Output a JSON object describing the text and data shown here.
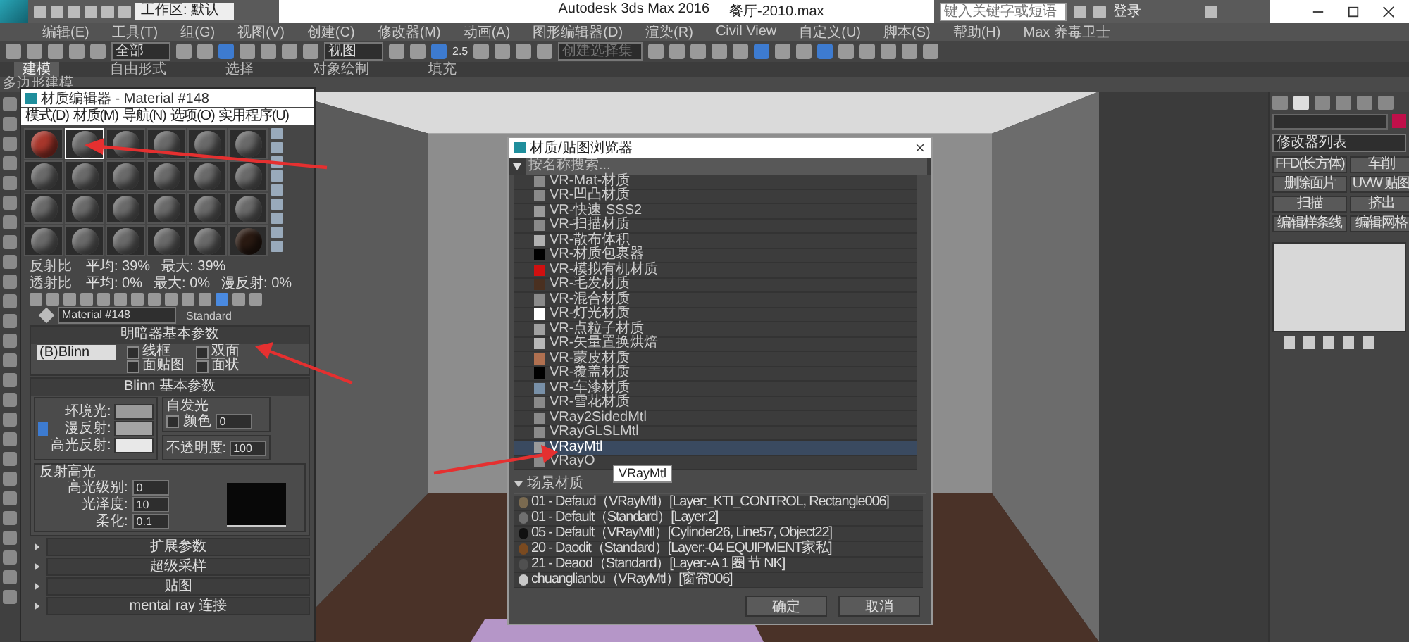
{
  "title_bar": {
    "workspace": "工作区: 默认",
    "app_title": "Autodesk 3ds Max 2016",
    "file_name": "餐厅-2010.max",
    "search": {
      "placeholder": "键入关键字或短语"
    },
    "user": "登录"
  },
  "menu_bar": [
    "编辑(E)",
    "工具(T)",
    "组(G)",
    "视图(V)",
    "创建(C)",
    "修改器(M)",
    "动画(A)",
    "图形编辑器(D)",
    "渲染(R)",
    "Civil View",
    "自定义(U)",
    "脚本(S)",
    "帮助(H)",
    "Max 养毒卫士"
  ],
  "toolbar": {
    "selection_filter": "全部",
    "coordinate_system": "视图",
    "snap_label": "2.5",
    "named_selection": {
      "placeholder": "创建选择集"
    }
  },
  "ribbon": {
    "tabs": [
      {
        "label": "建模",
        "selected": true
      },
      {
        "label": "自由形式",
        "selected": false
      },
      {
        "label": "选择",
        "selected": false
      },
      {
        "label": "对象绘制",
        "selected": false
      },
      {
        "label": "填充",
        "selected": false
      }
    ],
    "panel_label": "多边形建模"
  },
  "material_editor": {
    "title": "材质编辑器 - Material #148",
    "menu": [
      "模式(D)",
      "材质(M)",
      "导航(N)",
      "选项(O)",
      "实用程序(U)"
    ],
    "slots": [
      {
        "color": "#a8372c",
        "selected": false
      },
      {
        "color": "#6a6a6a",
        "selected": true
      },
      {
        "color": "#6a6a6a",
        "selected": false
      },
      {
        "color": "#6a6a6a",
        "selected": false
      },
      {
        "color": "#6a6a6a",
        "selected": false
      },
      {
        "color": "#6a6a6a",
        "selected": false
      },
      {
        "color": "#6a6a6a",
        "selected": false
      },
      {
        "color": "#6a6a6a",
        "selected": false
      },
      {
        "color": "#6a6a6a",
        "selected": false
      },
      {
        "color": "#6a6a6a",
        "selected": false
      },
      {
        "color": "#6a6a6a",
        "selected": false
      },
      {
        "color": "#6a6a6a",
        "selected": false
      },
      {
        "color": "#6a6a6a",
        "selected": false
      },
      {
        "color": "#6a6a6a",
        "selected": false
      },
      {
        "color": "#6a6a6a",
        "selected": false
      },
      {
        "color": "#6a6a6a",
        "selected": false
      },
      {
        "color": "#6a6a6a",
        "selected": false
      },
      {
        "color": "#6a6a6a",
        "selected": false
      },
      {
        "color": "#6a6a6a",
        "selected": false
      },
      {
        "color": "#6a6a6a",
        "selected": false
      },
      {
        "color": "#6a6a6a",
        "selected": false
      },
      {
        "color": "#6a6a6a",
        "selected": false
      },
      {
        "color": "#6a6a6a",
        "selected": false
      },
      {
        "color": "#2a1a12",
        "selected": false
      }
    ],
    "reflectance": {
      "title": "反射比",
      "values": [
        "平均: 39%",
        "最大: 39%"
      ]
    },
    "transmittance": {
      "title": "透射比",
      "values": [
        "平均: 0%",
        "最大: 0%",
        "漫反射: 0%"
      ]
    },
    "material_name": "Material #148",
    "material_type": "Standard",
    "shader": {
      "title": "明暗器基本参数",
      "shader_type": "(B)Blinn",
      "options": [
        {
          "label": "线框",
          "checked": false
        },
        {
          "label": "双面",
          "checked": false
        },
        {
          "label": "面贴图",
          "checked": false
        },
        {
          "label": "面状",
          "checked": false
        }
      ]
    },
    "blinn": {
      "title": "Blinn 基本参数",
      "self_illum": {
        "title": "自发光",
        "color_label": "颜色",
        "value": "0",
        "checked": false
      },
      "colors": [
        {
          "label": "环境光:",
          "color": "#9a9a9a"
        },
        {
          "label": "漫反射:",
          "color": "#a3a3a3"
        },
        {
          "label": "高光反射:",
          "color": "#e8e8e8"
        }
      ],
      "opacity": {
        "label": "不透明度:",
        "value": "100"
      },
      "highlights": {
        "title": "反射高光",
        "params": [
          {
            "label": "高光级别:",
            "value": "0"
          },
          {
            "label": "光泽度:",
            "value": "10"
          },
          {
            "label": "柔化:",
            "value": "0.1"
          }
        ]
      }
    },
    "rollouts": [
      {
        "title": "扩展参数",
        "expanded": false
      },
      {
        "title": "超级采样",
        "expanded": false
      },
      {
        "title": "贴图",
        "expanded": false
      },
      {
        "title": "mental ray 连接",
        "expanded": false
      }
    ]
  },
  "browser": {
    "title": "材质/贴图浏览器",
    "search": {
      "placeholder": "按名称搜索..."
    },
    "items": [
      {
        "label": "VR-Mat-材质",
        "color": "#8a8a8a",
        "selected": false
      },
      {
        "label": "VR-凹凸材质",
        "color": "#8a8a8a",
        "selected": false
      },
      {
        "label": "VR-快速 SSS2",
        "color": "#9a9a9a",
        "selected": false
      },
      {
        "label": "VR-扫描材质",
        "color": "#8a8a8a",
        "selected": false
      },
      {
        "label": "VR-散布体积",
        "color": "#b0b0b0",
        "selected": false
      },
      {
        "label": "VR-材质包裹器",
        "color": "#000000",
        "selected": false
      },
      {
        "label": "VR-模拟有机材质",
        "color": "#d01010",
        "selected": false
      },
      {
        "label": "VR-毛发材质",
        "color": "#4a3020",
        "selected": false
      },
      {
        "label": "VR-混合材质",
        "color": "#8a8a8a",
        "selected": false
      },
      {
        "label": "VR-灯光材质",
        "color": "#ffffff",
        "selected": false
      },
      {
        "label": "VR-点粒子材质",
        "color": "#a0a0a0",
        "selected": false
      },
      {
        "label": "VR-矢量置换烘焙",
        "color": "#b8b8b8",
        "selected": false
      },
      {
        "label": "VR-蒙皮材质",
        "color": "#b07050",
        "selected": false
      },
      {
        "label": "VR-覆盖材质",
        "color": "#000000",
        "selected": false
      },
      {
        "label": "VR-车漆材质",
        "color": "#7890a8",
        "selected": false
      },
      {
        "label": "VR-雪花材质",
        "color": "#8a8a8a",
        "selected": false
      },
      {
        "label": "VRay2SidedMtl",
        "color": "#8a8a8a",
        "selected": false
      },
      {
        "label": "VRayGLSLMtl",
        "color": "#8a8a8a",
        "selected": false
      },
      {
        "label": "VRayMtl",
        "color": "#9a9a9a",
        "selected": true
      },
      {
        "label": "VRayO",
        "color": "#8a8a8a",
        "selected": false
      }
    ],
    "tooltip": "VRayMtl",
    "scene_group": {
      "title": "场景材质",
      "expanded": true
    },
    "scene_items": [
      {
        "label": "01 - Defaud（VRayMtl）[Layer:_KTI_CONTROL, Rectangle006]",
        "color": "#7a6a50"
      },
      {
        "label": "01 - Default（Standard）[Layer:2]",
        "color": "#707070"
      },
      {
        "label": "05 - Default（VRayMtl）[Cylinder26, Line57, Object22]",
        "color": "#101010"
      },
      {
        "label": "20 - Daodit（Standard）[Layer:-04 EQUIPMENT家私]",
        "color": "#7a4a20"
      },
      {
        "label": "21 - Deaod（Standard）[Layer:-A 1 圈 节 NK]",
        "color": "#505050"
      },
      {
        "label": "chuanglianbu（VRayMtl）[窗帘006]",
        "color": "#c8c8c8"
      }
    ],
    "buttons": [
      "确定",
      "取消"
    ]
  },
  "command_panel": {
    "modifier_list": "修改器列表",
    "buttons": [
      "FFD(长方体)",
      "车削",
      "删除面片",
      "UVW 贴图",
      "扫描",
      "挤出",
      "编辑样条线",
      "编辑网格"
    ]
  }
}
